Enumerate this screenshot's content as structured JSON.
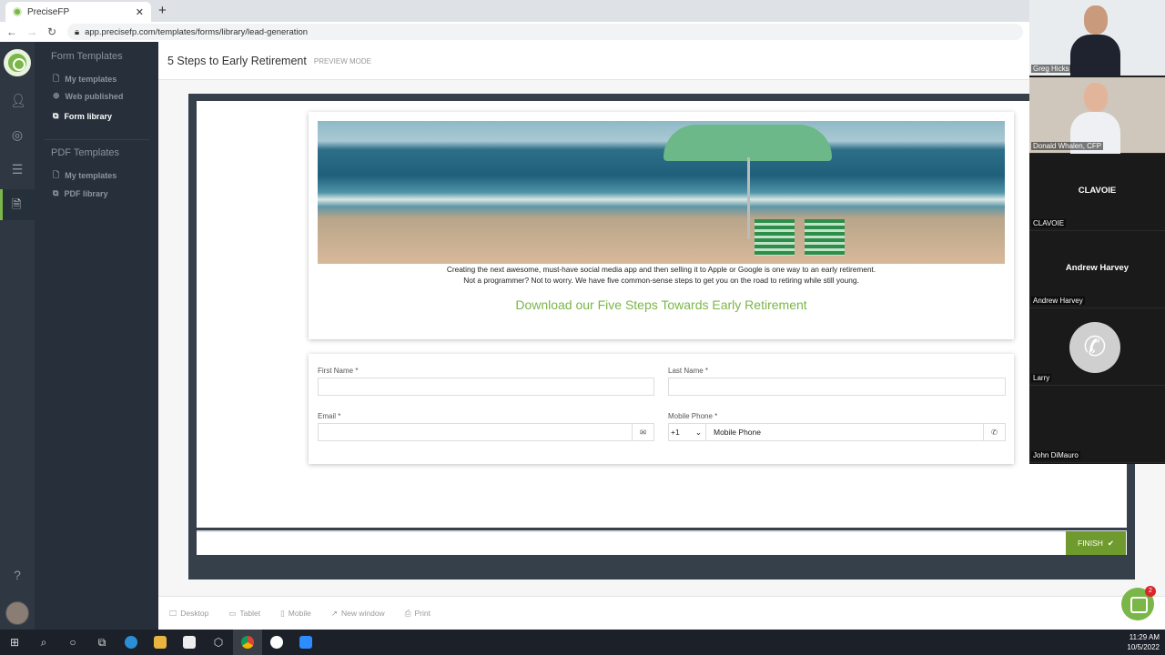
{
  "browser": {
    "tab_title": "PreciseFP",
    "url": "app.precisefp.com/templates/forms/library/lead-generation"
  },
  "sidebar": {
    "form_section": "Form Templates",
    "form_items": [
      {
        "label": "My templates"
      },
      {
        "label": "Web published"
      },
      {
        "label": "Form library"
      }
    ],
    "pdf_section": "PDF Templates",
    "pdf_items": [
      {
        "label": "My templates"
      },
      {
        "label": "PDF library"
      }
    ]
  },
  "header": {
    "title": "5 Steps to Early Retirement",
    "mode": "PREVIEW MODE"
  },
  "form": {
    "description_line1": "Creating the next awesome, must-have social media app and then selling it to Apple or Google is one way to an early retirement.",
    "description_line2": "Not a programmer? Not to worry. We have five common-sense steps to get you on the road to retiring while still young.",
    "download_heading": "Download our Five Steps Towards Early Retirement",
    "first_name_label": "First Name *",
    "last_name_label": "Last Name *",
    "email_label": "Email *",
    "phone_label": "Mobile Phone *",
    "country_code": "+1",
    "phone_placeholder": "Mobile Phone",
    "finish_label": "FINISH"
  },
  "footer": {
    "items": [
      {
        "label": "Desktop",
        "icon": "monitor-icon"
      },
      {
        "label": "Tablet",
        "icon": "tablet-icon"
      },
      {
        "label": "Mobile",
        "icon": "mobile-icon"
      },
      {
        "label": "New window",
        "icon": "external-link-icon"
      },
      {
        "label": "Print",
        "icon": "printer-icon"
      }
    ]
  },
  "chat": {
    "badge": "2"
  },
  "participants": [
    {
      "name": "Greg Hicks"
    },
    {
      "name": "Donald Whalen, CFP"
    },
    {
      "name": "CLAVOIE",
      "display": "CLAVOIE"
    },
    {
      "name": "Andrew Harvey",
      "display": "Andrew Harvey"
    },
    {
      "name": "Larry"
    },
    {
      "name": "John DiMauro"
    }
  ],
  "taskbar": {
    "time": "11:29 AM",
    "date": "10/5/2022"
  },
  "colors": {
    "accent": "#7ab648",
    "finish": "#6e9a2e",
    "sidebar": "#27303a"
  }
}
